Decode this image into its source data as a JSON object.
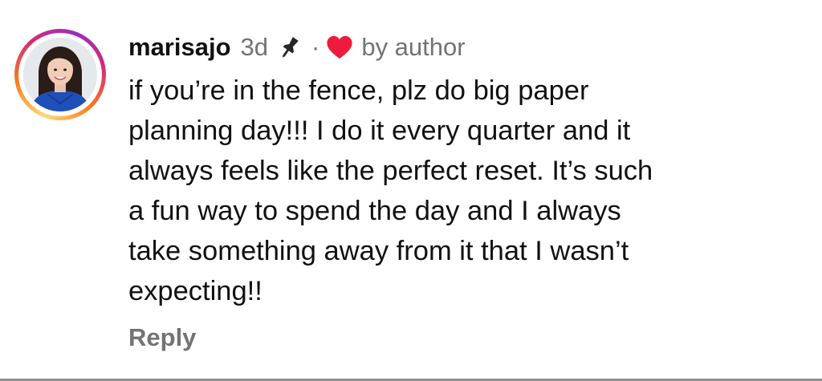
{
  "comment": {
    "username": "marisajo",
    "time_ago": "3d",
    "separator": "·",
    "liked_by_label": "by author",
    "body_lines": [
      "if you’re in the fence, plz do big paper",
      "planning day!!! I do it every quarter and it",
      "always feels like the perfect reset. It’s such",
      "a fun way to spend the day and I always",
      "take something away from it that I wasn’t",
      "expecting!!"
    ],
    "reply_label": "Reply",
    "icons": {
      "pin": "pin-icon",
      "heart": "heart-icon"
    }
  },
  "colors": {
    "primary_text": "#111111",
    "secondary_text": "#737373",
    "heart": "#ed1c3c",
    "divider": "#8e8e8e"
  }
}
